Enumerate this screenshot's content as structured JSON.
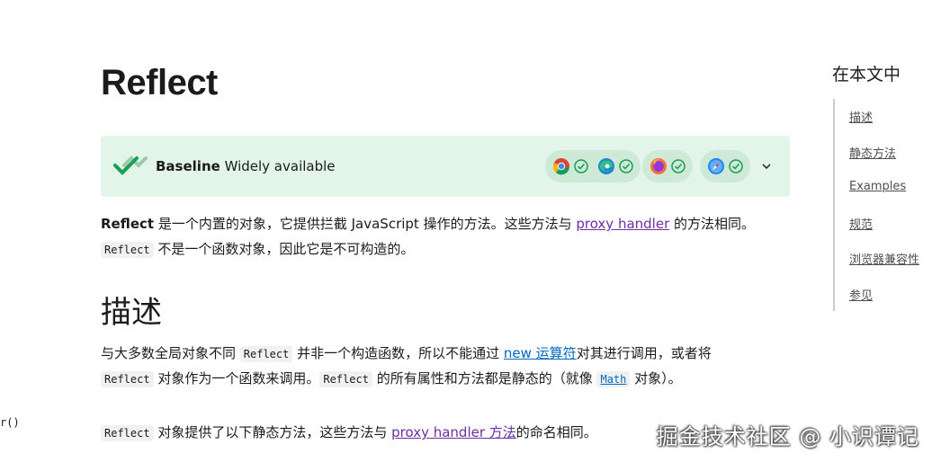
{
  "left_fragment": "r()",
  "page_title": "Reflect",
  "baseline": {
    "bold": "Baseline",
    "status": "Widely available"
  },
  "intro": {
    "p1_bold": "Reflect",
    "p1_a": " 是一个内置的对象，它提供拦截 JavaScript 操作的方法。这些方法与 ",
    "p1_link": "proxy handler",
    "p1_b": " 的方法相同。",
    "p2_code": "Reflect",
    "p2_a": " 不是一个函数对象，因此它是不可构造的。"
  },
  "section_heading": "描述",
  "desc": {
    "l1_a": "与大多数全局对象不同 ",
    "l1_code": "Reflect",
    "l1_b": " 并非一个构造函数，所以不能通过 ",
    "l1_link": "new 运算符",
    "l1_c": "对其进行调用，或者将",
    "l2_code": "Reflect",
    "l2_a": " 对象作为一个函数来调用。",
    "l2_code2": "Reflect",
    "l2_b": " 的所有属性和方法都是静态的（就像 ",
    "l2_code3": "Math",
    "l2_c": " 对象）。",
    "l3_code": "Reflect",
    "l3_a": " 对象提供了以下静态方法，这些方法与 ",
    "l3_link": "proxy handler 方法",
    "l3_b": "的命名相同。"
  },
  "toc": {
    "title": "在本文中",
    "items": [
      "描述",
      "静态方法",
      "Examples",
      "规范",
      "浏览器兼容性",
      "参见"
    ]
  },
  "watermark": "掘金技术社区 @ 小识谭记",
  "icons": {
    "baseline": "baseline-check-icon",
    "browsers": [
      "chrome-icon",
      "edge-icon",
      "firefox-icon",
      "safari-icon"
    ],
    "expand": "chevron-down-icon"
  },
  "colors": {
    "baseline_bg": "#e3f4e8",
    "pill_bg": "#cfe9d7",
    "link_visited": "#6e2ea4",
    "link": "#0069c2"
  }
}
